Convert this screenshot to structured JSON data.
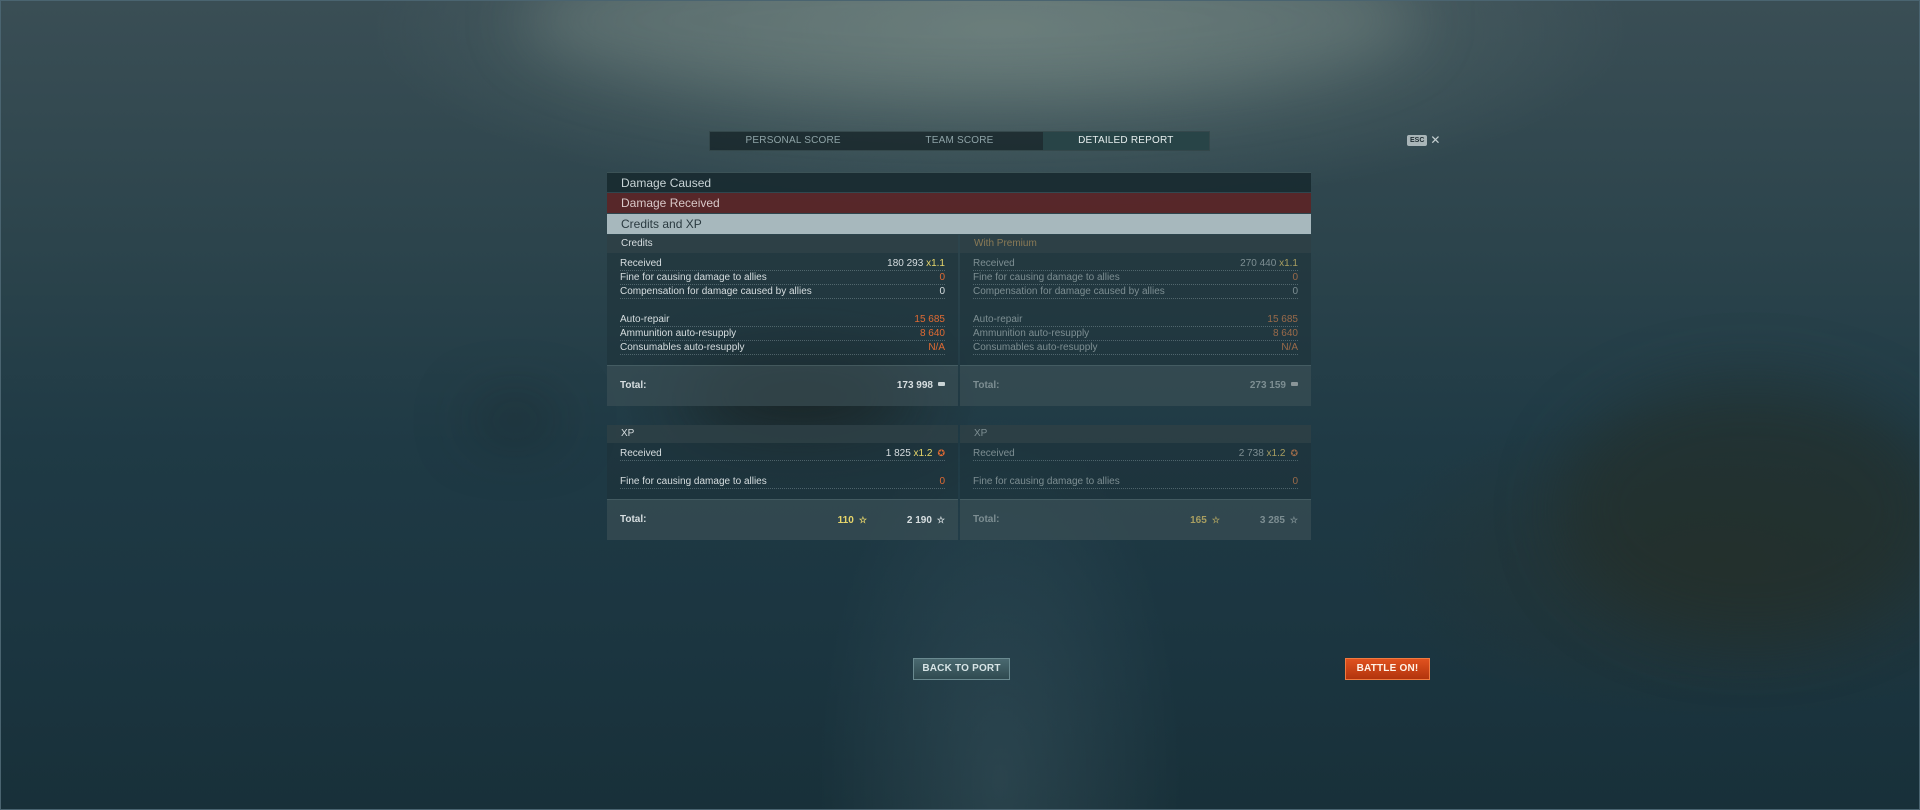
{
  "tabs": [
    {
      "label": "PERSONAL SCORE",
      "active": false
    },
    {
      "label": "TEAM SCORE",
      "active": false
    },
    {
      "label": "DETAILED REPORT",
      "active": true
    }
  ],
  "close": {
    "key_label": "ESC",
    "icon": "close-icon"
  },
  "sections": {
    "damage_caused": "Damage Caused",
    "damage_received": "Damage Received",
    "credits_xp": "Credits and XP"
  },
  "credits": {
    "standard": {
      "header": "Credits",
      "received_label": "Received",
      "received_value": "180 293",
      "received_mult": "x1.1",
      "fine_label": "Fine for causing damage to allies",
      "fine_value": "0",
      "comp_label": "Compensation for damage caused by allies",
      "comp_value": "0",
      "repair_label": "Auto-repair",
      "repair_value": "15 685",
      "ammo_label": "Ammunition auto-resupply",
      "ammo_value": "8 640",
      "cons_label": "Consumables auto-resupply",
      "cons_value": "N/A",
      "total_label": "Total:",
      "total_value": "173 998"
    },
    "premium": {
      "header": "With Premium",
      "received_label": "Received",
      "received_value": "270 440",
      "received_mult": "x1.1",
      "fine_label": "Fine for causing damage to allies",
      "fine_value": "0",
      "comp_label": "Compensation for damage caused by allies",
      "comp_value": "0",
      "repair_label": "Auto-repair",
      "repair_value": "15 685",
      "ammo_label": "Ammunition auto-resupply",
      "ammo_value": "8 640",
      "cons_label": "Consumables auto-resupply",
      "cons_value": "N/A",
      "total_label": "Total:",
      "total_value": "273 159"
    }
  },
  "xp": {
    "standard": {
      "header": "XP",
      "received_label": "Received",
      "received_value": "1 825",
      "received_mult": "x1.2",
      "fine_label": "Fine for causing damage to allies",
      "fine_value": "0",
      "total_label": "Total:",
      "free_xp": "110",
      "total_xp": "2 190"
    },
    "premium": {
      "header": "XP",
      "received_label": "Received",
      "received_value": "2 738",
      "received_mult": "x1.2",
      "fine_label": "Fine for causing damage to allies",
      "fine_value": "0",
      "total_label": "Total:",
      "free_xp": "165",
      "total_xp": "3 285"
    }
  },
  "buttons": {
    "back_to_port": "BACK TO PORT",
    "battle_on": "BATTLE ON!"
  },
  "colors": {
    "penalty": "#e06a33",
    "multiplier": "#e8d66a",
    "battle_button": "#d0441a",
    "damage_received_bar": "#5c2426",
    "credits_xp_bar": "#a7b8bd"
  }
}
